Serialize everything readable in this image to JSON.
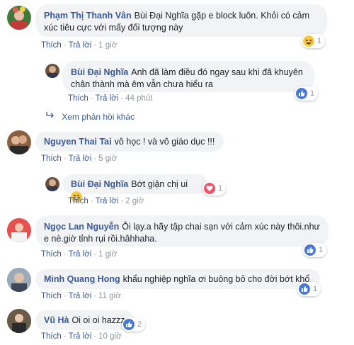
{
  "actions": {
    "like": "Thích",
    "reply": "Trả lời",
    "dot": "·"
  },
  "comments": [
    {
      "author": "Phạm Thị Thanh Vân",
      "text": "Bùi Đại Nghĩa gặp e block luôn. Khỏi có cảm xúc tiêu cực với mấy đối tượng này",
      "time": "1 giờ",
      "reaction": {
        "icon": "laughing-emoji-icon",
        "count": "1"
      }
    },
    {
      "author": "Bùi Đại Nghĩa",
      "text": "Anh đã làm điều đó ngay sau khi đã khuyên chân thành mà êm vẫn chưa hiểu ra",
      "time": "44 phút",
      "reaction": {
        "icon": "like-icon",
        "count": "1"
      }
    },
    {
      "author": "Nguyen Thai Tai",
      "text": "vô học ! và vô giáo dục !!!",
      "time": "5 giờ"
    },
    {
      "author": "Bùi Đại Nghĩa",
      "text": "Bớt giận chị ui",
      "time": "2 giờ",
      "reaction": {
        "icon": "heart-icon",
        "count": "1"
      }
    },
    {
      "author": "Ngọc Lan Nguyễn",
      "text": "Ôi lạy.a hãy tập chai sạn với cảm xúc này thôi.như e nè.giờ tỉnh rụi rồi.hâhhaha.",
      "time": "1 giờ",
      "reaction": {
        "icon": "like-icon",
        "count": "1"
      }
    },
    {
      "author": "Minh Quang Hong",
      "text": "khẩu nghiệp nghĩa ơi buông bỏ cho đời bớt khổ",
      "time": "11 giờ",
      "reaction": {
        "icon": "like-icon",
        "count": "1"
      }
    },
    {
      "author": "Vũ Hà",
      "text": "Oi oi oi hazzz",
      "time": "10 giờ",
      "reaction": {
        "icon": "like-icon",
        "count": "2"
      }
    }
  ],
  "more_replies": "Xem phản hồi khác",
  "colors": {
    "author": "#385898",
    "bubble": "#f2f3f5",
    "like": "#4a78d8",
    "heart": "#f25268"
  }
}
